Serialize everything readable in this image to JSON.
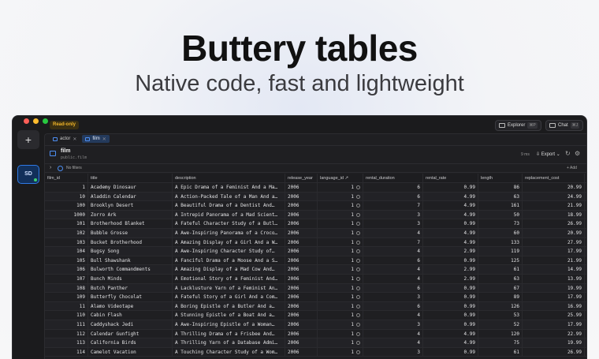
{
  "hero": {
    "title": "Buttery tables",
    "subtitle": "Native code, fast and lightweight"
  },
  "titlebar": {
    "readonly_badge": "Read-only",
    "explorer_label": "Explorer",
    "explorer_kbd": "⌘P",
    "chat_label": "Chat",
    "chat_kbd": "⌘J"
  },
  "sidebar": {
    "add_label": "+",
    "connection_label": "SD"
  },
  "tabs": [
    {
      "label": "actor",
      "active": false
    },
    {
      "label": "film",
      "active": true
    }
  ],
  "table": {
    "name": "film",
    "schema": "public.film",
    "timing": "9 ms",
    "export_label": "Export",
    "filter_text": "No filters",
    "add_label": "+ Add"
  },
  "columns": [
    "film_id",
    "title",
    "description",
    "release_year",
    "language_id",
    "rental_duration",
    "rental_rate",
    "length",
    "replacement_cost"
  ],
  "rows": [
    [
      "1",
      "Academy Dinosaur",
      "A Epic Drama of a Feminist And a Ma…",
      "2006",
      "1",
      "6",
      "0.99",
      "86",
      "20.99"
    ],
    [
      "10",
      "Aladdin Calendar",
      "A Action-Packed Tale of a Man And a…",
      "2006",
      "1",
      "6",
      "4.99",
      "63",
      "24.99"
    ],
    [
      "100",
      "Brooklyn Desert",
      "A Beautiful Drama of a Dentist And…",
      "2006",
      "1",
      "7",
      "4.99",
      "161",
      "21.99"
    ],
    [
      "1000",
      "Zorro Ark",
      "A Intrepid Panorama of a Mad Scient…",
      "2006",
      "1",
      "3",
      "4.99",
      "50",
      "18.99"
    ],
    [
      "101",
      "Brotherhood Blanket",
      "A Fateful Character Study of a Butl…",
      "2006",
      "1",
      "3",
      "0.99",
      "73",
      "26.99"
    ],
    [
      "102",
      "Bubble Grosse",
      "A Awe-Inspiring Panorama of a Croco…",
      "2006",
      "1",
      "4",
      "4.99",
      "60",
      "20.99"
    ],
    [
      "103",
      "Bucket Brotherhood",
      "A Amazing Display of a Girl And a W…",
      "2006",
      "1",
      "7",
      "4.99",
      "133",
      "27.99"
    ],
    [
      "104",
      "Bugsy Song",
      "A Awe-Inspiring Character Study of…",
      "2006",
      "1",
      "4",
      "2.99",
      "119",
      "17.99"
    ],
    [
      "105",
      "Bull Shawshank",
      "A Fanciful Drama of a Moose And a S…",
      "2006",
      "1",
      "6",
      "0.99",
      "125",
      "21.99"
    ],
    [
      "106",
      "Bulworth Commandments",
      "A Amazing Display of a Mad Cow And…",
      "2006",
      "1",
      "4",
      "2.99",
      "61",
      "14.99"
    ],
    [
      "107",
      "Bunch Minds",
      "A Emotional Story of a Feminist And…",
      "2006",
      "1",
      "4",
      "2.99",
      "63",
      "13.99"
    ],
    [
      "108",
      "Butch Panther",
      "A Lacklusture Yarn of a Feminist An…",
      "2006",
      "1",
      "6",
      "0.99",
      "67",
      "19.99"
    ],
    [
      "109",
      "Butterfly Chocolat",
      "A Fateful Story of a Girl And a Com…",
      "2006",
      "1",
      "3",
      "0.99",
      "89",
      "17.99"
    ],
    [
      "11",
      "Alamo Videotape",
      "A Boring Epistle of a Butler And a…",
      "2006",
      "1",
      "6",
      "0.99",
      "126",
      "16.99"
    ],
    [
      "110",
      "Cabin Flash",
      "A Stunning Epistle of a Boat And a…",
      "2006",
      "1",
      "4",
      "0.99",
      "53",
      "25.99"
    ],
    [
      "111",
      "Caddyshack Jedi",
      "A Awe-Inspiring Epistle of a Woman…",
      "2006",
      "1",
      "3",
      "0.99",
      "52",
      "17.99"
    ],
    [
      "112",
      "Calendar Gunfight",
      "A Thrilling Drama of a Frisbee And…",
      "2006",
      "1",
      "4",
      "4.99",
      "120",
      "22.99"
    ],
    [
      "113",
      "California Birds",
      "A Thrilling Yarn of a Database Admi…",
      "2006",
      "1",
      "4",
      "4.99",
      "75",
      "19.99"
    ],
    [
      "114",
      "Camelot Vacation",
      "A Touching Character Study of a Wom…",
      "2006",
      "1",
      "3",
      "0.99",
      "61",
      "26.99"
    ]
  ]
}
